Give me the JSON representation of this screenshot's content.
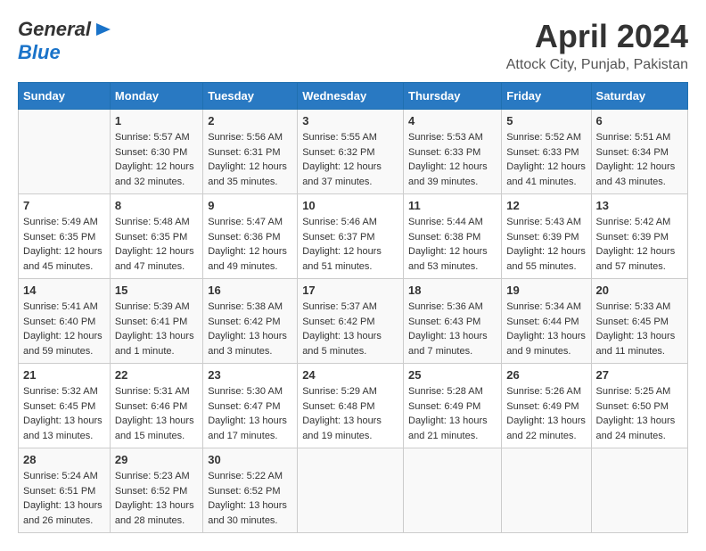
{
  "header": {
    "logo_line1": "General",
    "logo_line2": "Blue",
    "main_title": "April 2024",
    "subtitle": "Attock City, Punjab, Pakistan"
  },
  "calendar": {
    "weekdays": [
      "Sunday",
      "Monday",
      "Tuesday",
      "Wednesday",
      "Thursday",
      "Friday",
      "Saturday"
    ],
    "weeks": [
      [
        {
          "day": "",
          "sunrise": "",
          "sunset": "",
          "daylight": ""
        },
        {
          "day": "1",
          "sunrise": "Sunrise: 5:57 AM",
          "sunset": "Sunset: 6:30 PM",
          "daylight": "Daylight: 12 hours and 32 minutes."
        },
        {
          "day": "2",
          "sunrise": "Sunrise: 5:56 AM",
          "sunset": "Sunset: 6:31 PM",
          "daylight": "Daylight: 12 hours and 35 minutes."
        },
        {
          "day": "3",
          "sunrise": "Sunrise: 5:55 AM",
          "sunset": "Sunset: 6:32 PM",
          "daylight": "Daylight: 12 hours and 37 minutes."
        },
        {
          "day": "4",
          "sunrise": "Sunrise: 5:53 AM",
          "sunset": "Sunset: 6:33 PM",
          "daylight": "Daylight: 12 hours and 39 minutes."
        },
        {
          "day": "5",
          "sunrise": "Sunrise: 5:52 AM",
          "sunset": "Sunset: 6:33 PM",
          "daylight": "Daylight: 12 hours and 41 minutes."
        },
        {
          "day": "6",
          "sunrise": "Sunrise: 5:51 AM",
          "sunset": "Sunset: 6:34 PM",
          "daylight": "Daylight: 12 hours and 43 minutes."
        }
      ],
      [
        {
          "day": "7",
          "sunrise": "Sunrise: 5:49 AM",
          "sunset": "Sunset: 6:35 PM",
          "daylight": "Daylight: 12 hours and 45 minutes."
        },
        {
          "day": "8",
          "sunrise": "Sunrise: 5:48 AM",
          "sunset": "Sunset: 6:35 PM",
          "daylight": "Daylight: 12 hours and 47 minutes."
        },
        {
          "day": "9",
          "sunrise": "Sunrise: 5:47 AM",
          "sunset": "Sunset: 6:36 PM",
          "daylight": "Daylight: 12 hours and 49 minutes."
        },
        {
          "day": "10",
          "sunrise": "Sunrise: 5:46 AM",
          "sunset": "Sunset: 6:37 PM",
          "daylight": "Daylight: 12 hours and 51 minutes."
        },
        {
          "day": "11",
          "sunrise": "Sunrise: 5:44 AM",
          "sunset": "Sunset: 6:38 PM",
          "daylight": "Daylight: 12 hours and 53 minutes."
        },
        {
          "day": "12",
          "sunrise": "Sunrise: 5:43 AM",
          "sunset": "Sunset: 6:39 PM",
          "daylight": "Daylight: 12 hours and 55 minutes."
        },
        {
          "day": "13",
          "sunrise": "Sunrise: 5:42 AM",
          "sunset": "Sunset: 6:39 PM",
          "daylight": "Daylight: 12 hours and 57 minutes."
        }
      ],
      [
        {
          "day": "14",
          "sunrise": "Sunrise: 5:41 AM",
          "sunset": "Sunset: 6:40 PM",
          "daylight": "Daylight: 12 hours and 59 minutes."
        },
        {
          "day": "15",
          "sunrise": "Sunrise: 5:39 AM",
          "sunset": "Sunset: 6:41 PM",
          "daylight": "Daylight: 13 hours and 1 minute."
        },
        {
          "day": "16",
          "sunrise": "Sunrise: 5:38 AM",
          "sunset": "Sunset: 6:42 PM",
          "daylight": "Daylight: 13 hours and 3 minutes."
        },
        {
          "day": "17",
          "sunrise": "Sunrise: 5:37 AM",
          "sunset": "Sunset: 6:42 PM",
          "daylight": "Daylight: 13 hours and 5 minutes."
        },
        {
          "day": "18",
          "sunrise": "Sunrise: 5:36 AM",
          "sunset": "Sunset: 6:43 PM",
          "daylight": "Daylight: 13 hours and 7 minutes."
        },
        {
          "day": "19",
          "sunrise": "Sunrise: 5:34 AM",
          "sunset": "Sunset: 6:44 PM",
          "daylight": "Daylight: 13 hours and 9 minutes."
        },
        {
          "day": "20",
          "sunrise": "Sunrise: 5:33 AM",
          "sunset": "Sunset: 6:45 PM",
          "daylight": "Daylight: 13 hours and 11 minutes."
        }
      ],
      [
        {
          "day": "21",
          "sunrise": "Sunrise: 5:32 AM",
          "sunset": "Sunset: 6:45 PM",
          "daylight": "Daylight: 13 hours and 13 minutes."
        },
        {
          "day": "22",
          "sunrise": "Sunrise: 5:31 AM",
          "sunset": "Sunset: 6:46 PM",
          "daylight": "Daylight: 13 hours and 15 minutes."
        },
        {
          "day": "23",
          "sunrise": "Sunrise: 5:30 AM",
          "sunset": "Sunset: 6:47 PM",
          "daylight": "Daylight: 13 hours and 17 minutes."
        },
        {
          "day": "24",
          "sunrise": "Sunrise: 5:29 AM",
          "sunset": "Sunset: 6:48 PM",
          "daylight": "Daylight: 13 hours and 19 minutes."
        },
        {
          "day": "25",
          "sunrise": "Sunrise: 5:28 AM",
          "sunset": "Sunset: 6:49 PM",
          "daylight": "Daylight: 13 hours and 21 minutes."
        },
        {
          "day": "26",
          "sunrise": "Sunrise: 5:26 AM",
          "sunset": "Sunset: 6:49 PM",
          "daylight": "Daylight: 13 hours and 22 minutes."
        },
        {
          "day": "27",
          "sunrise": "Sunrise: 5:25 AM",
          "sunset": "Sunset: 6:50 PM",
          "daylight": "Daylight: 13 hours and 24 minutes."
        }
      ],
      [
        {
          "day": "28",
          "sunrise": "Sunrise: 5:24 AM",
          "sunset": "Sunset: 6:51 PM",
          "daylight": "Daylight: 13 hours and 26 minutes."
        },
        {
          "day": "29",
          "sunrise": "Sunrise: 5:23 AM",
          "sunset": "Sunset: 6:52 PM",
          "daylight": "Daylight: 13 hours and 28 minutes."
        },
        {
          "day": "30",
          "sunrise": "Sunrise: 5:22 AM",
          "sunset": "Sunset: 6:52 PM",
          "daylight": "Daylight: 13 hours and 30 minutes."
        },
        {
          "day": "",
          "sunrise": "",
          "sunset": "",
          "daylight": ""
        },
        {
          "day": "",
          "sunrise": "",
          "sunset": "",
          "daylight": ""
        },
        {
          "day": "",
          "sunrise": "",
          "sunset": "",
          "daylight": ""
        },
        {
          "day": "",
          "sunrise": "",
          "sunset": "",
          "daylight": ""
        }
      ]
    ]
  }
}
